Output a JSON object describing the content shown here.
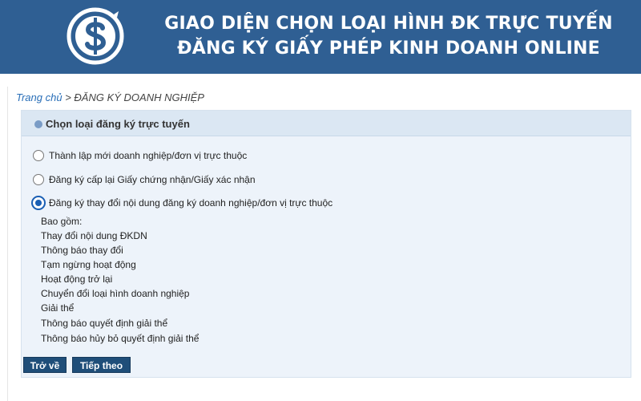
{
  "header": {
    "title_line1": "GIAO DIỆN CHỌN LOẠI HÌNH ĐK TRỰC TUYẾN",
    "title_line2": "ĐĂNG KÝ GIẤY PHÉP KINH DOANH ONLINE",
    "logo_icon": "dollar-coin-logo",
    "color": "#2f5f93"
  },
  "breadcrumb": {
    "home": "Trang chủ",
    "separator": ">",
    "current": "ĐĂNG KÝ DOANH NGHIỆP"
  },
  "panel": {
    "title": "Chọn loại đăng ký trực tuyến",
    "options": [
      {
        "label": "Thành lập mới doanh nghiệp/đơn vị trực thuộc",
        "selected": false
      },
      {
        "label": "Đăng ký cấp lại Giấy chứng nhận/Giấy xác nhận",
        "selected": false
      },
      {
        "label": "Đăng ký thay đổi nội dung đăng ký doanh nghiệp/đơn vị trực thuộc",
        "selected": true
      }
    ],
    "includes_label": "Bao gồm:",
    "includes": [
      "Thay đổi nội dung ĐKDN",
      "Thông báo thay đổi",
      "Tạm ngừng hoạt động",
      "Hoạt động trở lại",
      "Chuyển đổi loại hình doanh nghiệp",
      "Giải thể",
      "Thông báo quyết định giải thể",
      "Thông báo hủy bỏ quyết định giải thể"
    ]
  },
  "buttons": {
    "back": "Trở về",
    "next": "Tiếp theo",
    "color": "#1f4e79"
  }
}
